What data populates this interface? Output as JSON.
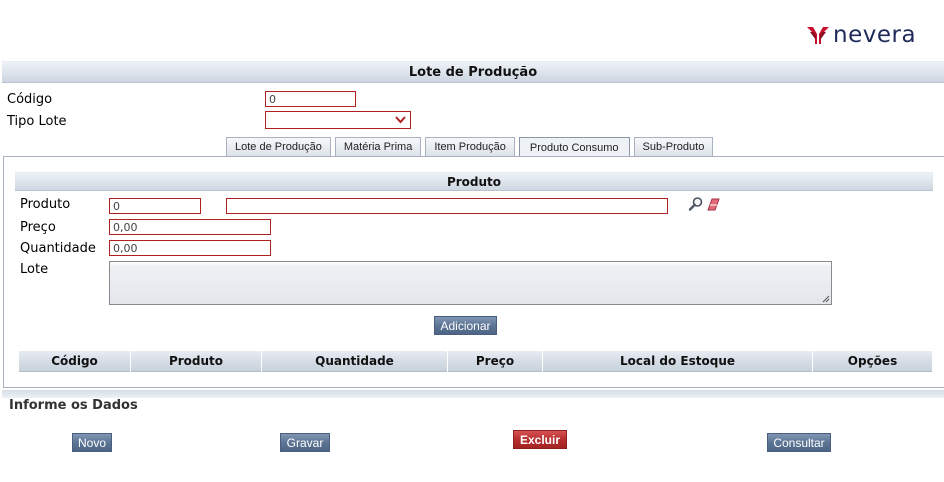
{
  "brand": {
    "name": "nevera"
  },
  "title": "Lote de Produção",
  "form": {
    "codigo_label": "Código",
    "codigo_value": "0",
    "tipo_lote_label": "Tipo Lote",
    "tipo_lote_value": ""
  },
  "tabs": [
    {
      "label": "Lote de Produção",
      "active": false
    },
    {
      "label": "Matéria Prima",
      "active": false
    },
    {
      "label": "Item Produção",
      "active": false
    },
    {
      "label": "Produto Consumo",
      "active": true
    },
    {
      "label": "Sub-Produto",
      "active": false
    }
  ],
  "produto_section": {
    "title": "Produto",
    "produto_label": "Produto",
    "produto_code": "0",
    "produto_desc": "",
    "preco_label": "Preço",
    "preco_value": "0,00",
    "quantidade_label": "Quantidade",
    "quantidade_value": "0,00",
    "lote_label": "Lote",
    "lote_value": "",
    "add_button": "Adicionar"
  },
  "table": {
    "columns": [
      "Código",
      "Produto",
      "Quantidade",
      "Preço",
      "Local do Estoque",
      "Opções"
    ],
    "rows": []
  },
  "footer": {
    "section_title": "Informe os Dados",
    "buttons": {
      "novo": "Novo",
      "gravar": "Gravar",
      "excluir": "Excluir",
      "consultar": "Consultar"
    }
  },
  "colors": {
    "brand_red": "#c8102e",
    "brand_navy": "#1f2a5a",
    "field_border": "#b0201f",
    "button_blue": "#5d7595",
    "button_red": "#b72e2e"
  },
  "icons": [
    "search-icon",
    "eraser-icon",
    "chevron-down-icon",
    "resize-grip-icon"
  ]
}
